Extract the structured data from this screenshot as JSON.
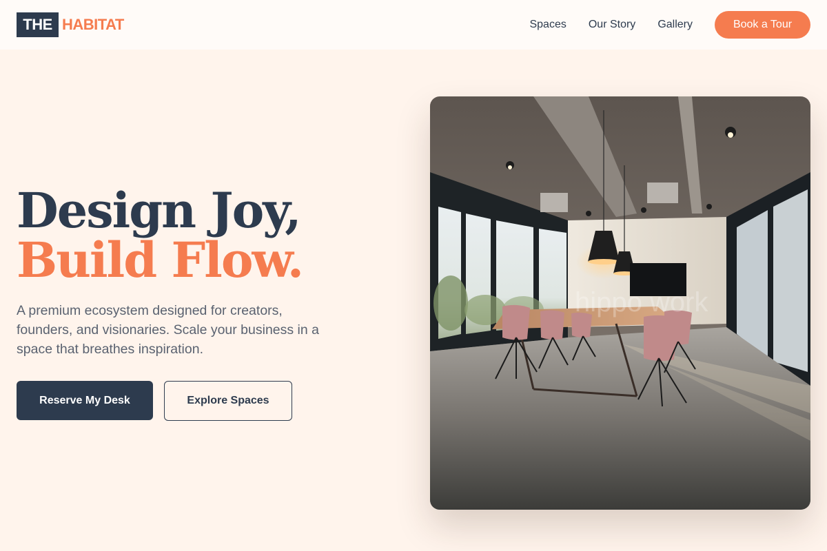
{
  "brand": {
    "logo_part1": "THE",
    "logo_part2": "HABITAT",
    "primary_color": "#2d3b4e",
    "accent_color": "#f57c4f",
    "background_color": "#fff4ec"
  },
  "nav": {
    "links": [
      "Spaces",
      "Our Story",
      "Gallery"
    ],
    "cta_label": "Book a Tour"
  },
  "hero": {
    "title_line1": "Design Joy,",
    "title_line2": "Build Flow.",
    "description": "A premium ecosystem designed for creators, founders, and visionaries. Scale your business in a space that breathes inspiration.",
    "primary_button": "Reserve My Desk",
    "secondary_button": "Explore Spaces",
    "image_watermark": "hippo work"
  }
}
